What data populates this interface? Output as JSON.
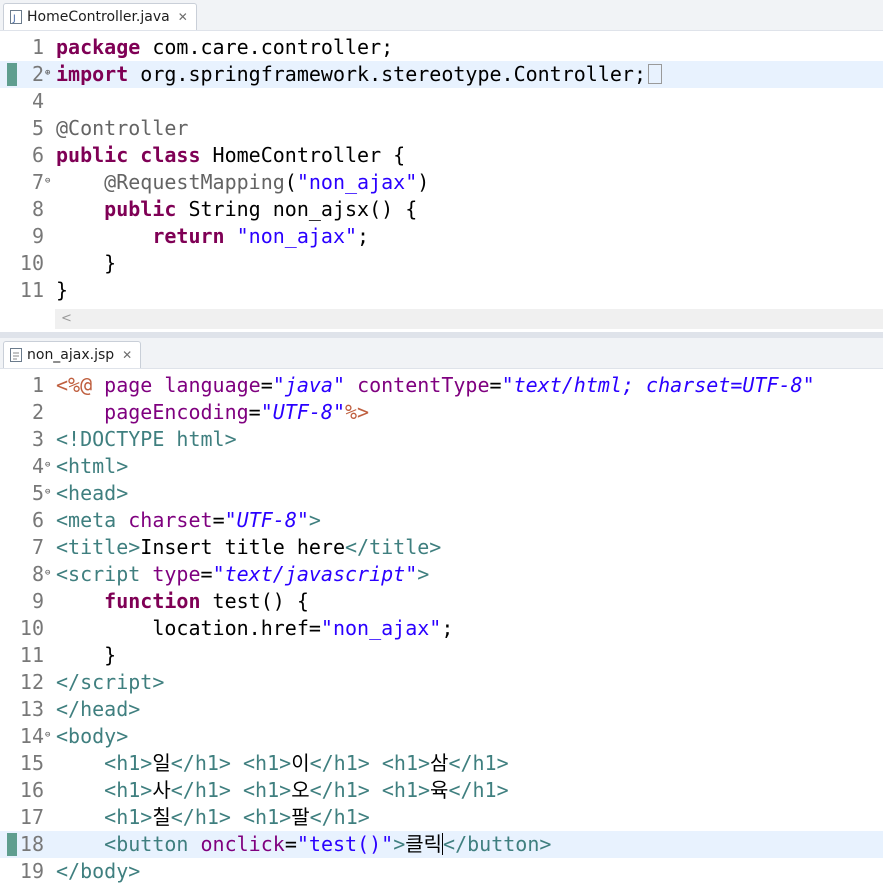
{
  "editor1": {
    "tab": {
      "title": "HomeController.java",
      "close": "✕",
      "icon": "java-file-icon"
    },
    "lines": [
      {
        "n": "1",
        "html": "<span class=\"kw\">package</span> com.care.controller;"
      },
      {
        "n": "2",
        "fold": "⊕",
        "marker": true,
        "current": true,
        "html": "<span class=\"kw\">import</span> org.springframework.stereotype.Controller;<span class=\"ellipsis\"></span>"
      },
      {
        "n": "4",
        "html": ""
      },
      {
        "n": "5",
        "html": "<span class=\"ann\">@Controller</span>"
      },
      {
        "n": "6",
        "html": "<span class=\"kw\">public</span> <span class=\"kw\">class</span> HomeController {"
      },
      {
        "n": "7",
        "fold": "⊖",
        "html": "    <span class=\"ann\">@RequestMapping</span>(<span class=\"str\">\"non_ajax\"</span>)"
      },
      {
        "n": "8",
        "html": "    <span class=\"kw\">public</span> String non_ajsx() {"
      },
      {
        "n": "9",
        "html": "        <span class=\"kw\">return</span> <span class=\"str\">\"non_ajax\"</span>;"
      },
      {
        "n": "10",
        "html": "    }"
      },
      {
        "n": "11",
        "html": "}"
      }
    ]
  },
  "editor2": {
    "tab": {
      "title": "non_ajax.jsp",
      "close": "✕",
      "icon": "jsp-file-icon"
    },
    "lines": [
      {
        "n": "1",
        "html": "<span class=\"dir\">&lt;%@</span> <span class=\"attr\">page</span> <span class=\"attr\">language</span>=<span class=\"aval\">\"java\"</span> <span class=\"attr\">contentType</span>=<span class=\"aval\">\"text/html; charset=UTF-8\"</span>"
      },
      {
        "n": "2",
        "html": "    <span class=\"attr\">pageEncoding</span>=<span class=\"aval\">\"UTF-8\"</span><span class=\"dir\">%&gt;</span>"
      },
      {
        "n": "3",
        "html": "<span class=\"tag\">&lt;!DOCTYPE html&gt;</span>"
      },
      {
        "n": "4",
        "fold": "⊖",
        "html": "<span class=\"tag\">&lt;html&gt;</span>"
      },
      {
        "n": "5",
        "fold": "⊖",
        "html": "<span class=\"tag\">&lt;head&gt;</span>"
      },
      {
        "n": "6",
        "html": "<span class=\"tag\">&lt;meta</span> <span class=\"attr\">charset</span>=<span class=\"aval\">\"UTF-8\"</span><span class=\"tag\">&gt;</span>"
      },
      {
        "n": "7",
        "html": "<span class=\"tag\">&lt;title&gt;</span>Insert title here<span class=\"tag\">&lt;/title&gt;</span>"
      },
      {
        "n": "8",
        "fold": "⊖",
        "html": "<span class=\"tag\">&lt;script</span> <span class=\"attr\">type</span>=<span class=\"aval\">\"text/javascript\"</span><span class=\"tag\">&gt;</span>"
      },
      {
        "n": "9",
        "html": "    <span class=\"kw\">function</span> test() {"
      },
      {
        "n": "10",
        "html": "        location.href=<span class=\"str\">\"non_ajax\"</span>;"
      },
      {
        "n": "11",
        "html": "    }"
      },
      {
        "n": "12",
        "html": "<span class=\"tag\">&lt;/script&gt;</span>"
      },
      {
        "n": "13",
        "html": "<span class=\"tag\">&lt;/head&gt;</span>"
      },
      {
        "n": "14",
        "fold": "⊖",
        "html": "<span class=\"tag\">&lt;body&gt;</span>"
      },
      {
        "n": "15",
        "html": "    <span class=\"tag\">&lt;h1&gt;</span>일<span class=\"tag\">&lt;/h1&gt;</span> <span class=\"tag\">&lt;h1&gt;</span>이<span class=\"tag\">&lt;/h1&gt;</span> <span class=\"tag\">&lt;h1&gt;</span>삼<span class=\"tag\">&lt;/h1&gt;</span>"
      },
      {
        "n": "16",
        "html": "    <span class=\"tag\">&lt;h1&gt;</span>사<span class=\"tag\">&lt;/h1&gt;</span> <span class=\"tag\">&lt;h1&gt;</span>오<span class=\"tag\">&lt;/h1&gt;</span> <span class=\"tag\">&lt;h1&gt;</span>육<span class=\"tag\">&lt;/h1&gt;</span>"
      },
      {
        "n": "17",
        "html": "    <span class=\"tag\">&lt;h1&gt;</span>칠<span class=\"tag\">&lt;/h1&gt;</span> <span class=\"tag\">&lt;h1&gt;</span>팔<span class=\"tag\">&lt;/h1&gt;</span>"
      },
      {
        "n": "18",
        "marker": true,
        "current": true,
        "html": "    <span class=\"tag\">&lt;button</span> <span class=\"attr\">onclick</span>=<span class=\"str\">\"test()\"</span><span class=\"tag\">&gt;</span>클릭<span class=\"caret\"></span><span class=\"tag\">&lt;/button&gt;</span>"
      },
      {
        "n": "19",
        "html": "<span class=\"tag\">&lt;/body&gt;</span>"
      }
    ]
  },
  "scrollbar": {
    "left_arrow": "<"
  }
}
